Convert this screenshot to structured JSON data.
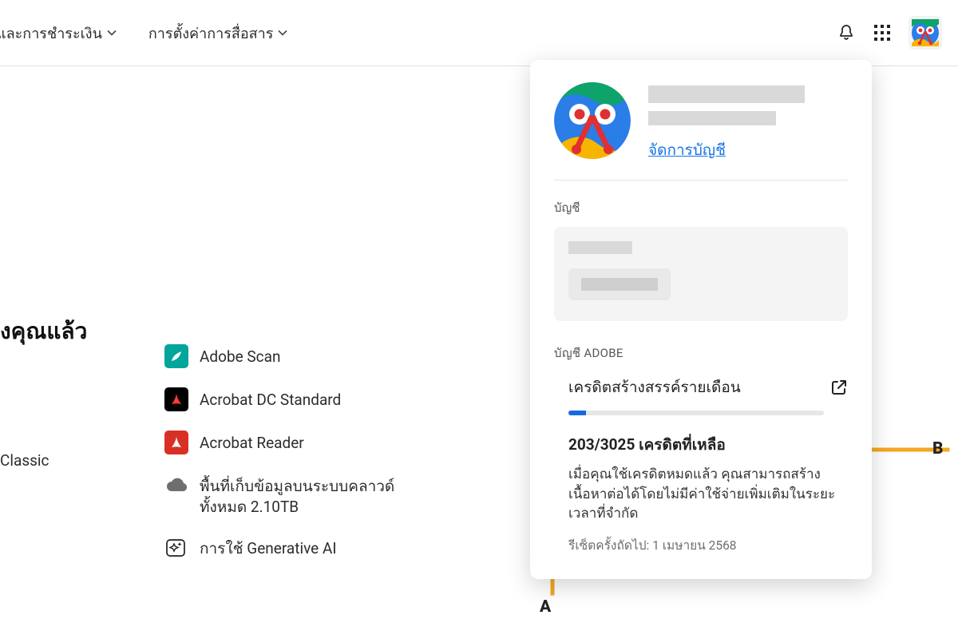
{
  "topnav": {
    "payment": "และการชําระเงิน",
    "comm": "การตั้งค่าการสื่อสาร"
  },
  "section_title": "งคุณแล้ว",
  "col1": {
    "classic": "Classic"
  },
  "apps": {
    "scan": "Adobe Scan",
    "acrobat": "Acrobat DC Standard",
    "reader": "Acrobat Reader",
    "storage": "พื้นที่เก็บข้อมูลบนระบบคลาวด์ทั้งหมด 2.10TB",
    "genai": "การใช้ Generative AI"
  },
  "popover": {
    "manage": "จัดการบัญชี",
    "account_label": "บัญชี",
    "adobe_label": "บัญชี ADOBE",
    "credit_title": "เครดิตสร้างสรรค์รายเดือน",
    "credit_count": "203/3025 เครดิตที่เหลือ",
    "credit_desc": "เมื่อคุณใช้เครดิตหมดแล้ว คุณสามารถสร้างเนื้อหาต่อได้โดยไม่มีค่าใช้จ่ายเพิ่มเติมในระยะเวลาที่จํากัด",
    "credit_reset": "รีเซ็ตครั้งถัดไป: 1 เมษายน 2568"
  },
  "annotations": {
    "a": "A",
    "b": "B"
  }
}
